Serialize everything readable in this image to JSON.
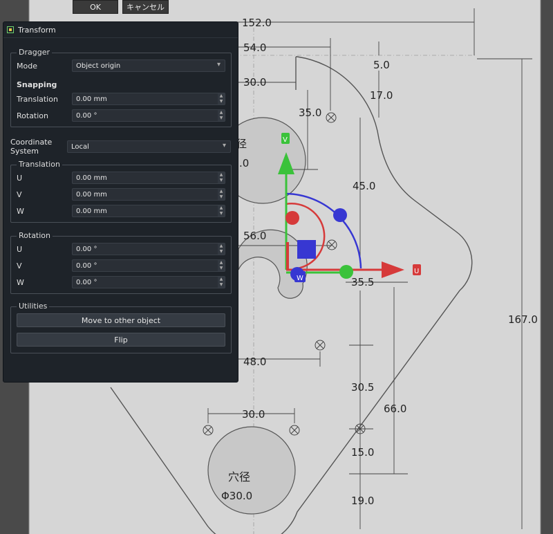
{
  "dialog": {
    "ok_label": "OK",
    "cancel_label": "キャンセル"
  },
  "panel": {
    "title": "Transform",
    "dragger": {
      "legend": "Dragger",
      "mode_label": "Mode",
      "mode_value": "Object origin",
      "snapping_label": "Snapping",
      "translation_label": "Translation",
      "translation_value": "0.00 mm",
      "rotation_label": "Rotation",
      "rotation_value": "0.00 °"
    },
    "coord": {
      "label": "Coordinate System",
      "value": "Local"
    },
    "translation": {
      "legend": "Translation",
      "u_label": "U",
      "u_value": "0.00 mm",
      "v_label": "V",
      "v_value": "0.00 mm",
      "w_label": "W",
      "w_value": "0.00 mm"
    },
    "rotation": {
      "legend": "Rotation",
      "u_label": "U",
      "u_value": "0.00 °",
      "v_label": "V",
      "v_value": "0.00 °",
      "w_label": "W",
      "w_value": "0.00 °"
    },
    "utilities": {
      "legend": "Utilities",
      "move_label": "Move to other object",
      "flip_label": "Flip"
    }
  },
  "drawing": {
    "dims": {
      "d152": "152.0",
      "d54": "54.0",
      "d30a": "30.0",
      "d35": "35.0",
      "d5": "5.0",
      "d17": "17.0",
      "d45": "45.0",
      "d56": "56.0",
      "d355": "35.5",
      "d167": "167.0",
      "d48": "48.0",
      "d305": "30.5",
      "d66": "66.0",
      "d30b": "30.0",
      "d15": "15.0",
      "d19": "19.0",
      "frag0": ".0"
    },
    "hole_label": "穴径",
    "hole_label_partial": "径",
    "hole_dia": "Φ30.0"
  },
  "gizmo": {
    "u_label": "U",
    "v_label": "V",
    "w_label": "W"
  },
  "colors": {
    "u_axis": "#d63a3a",
    "v_axis": "#3ac23a",
    "w_axis": "#3737d2",
    "panel_bg": "#1e2329",
    "paper": "#d6d6d6"
  }
}
